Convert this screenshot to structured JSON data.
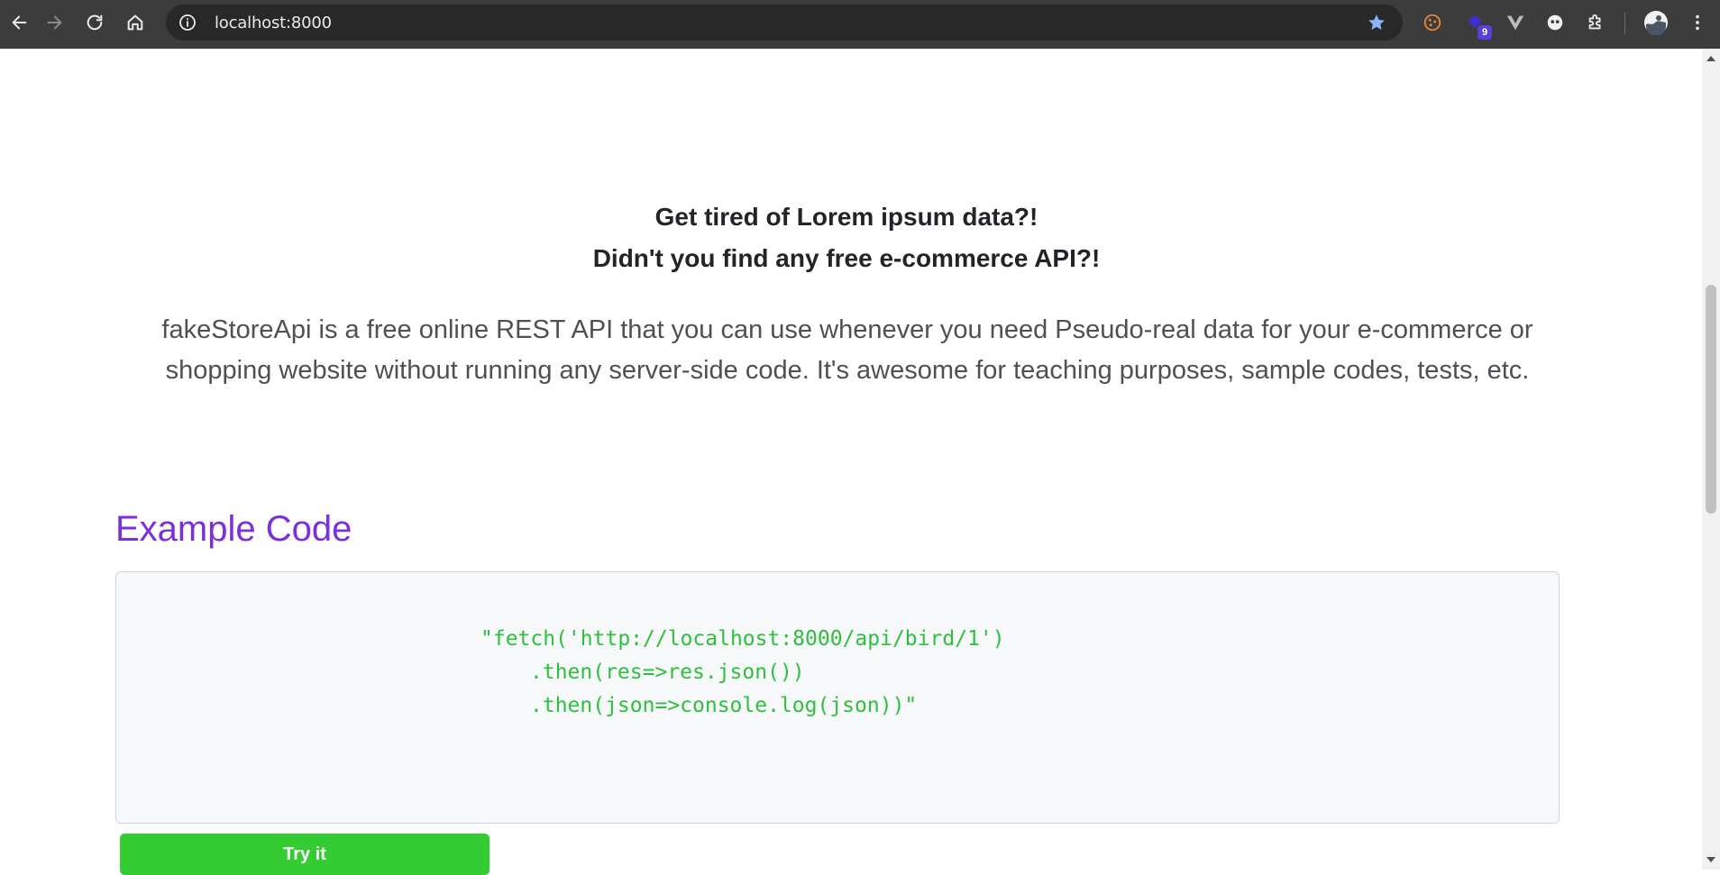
{
  "browser": {
    "url": "localhost:8000",
    "extension_badge_count": "9",
    "colors": {
      "chrome_bg": "#3c3c3c",
      "omnibox_bg": "#282828",
      "star": "#8ab4f8"
    },
    "icons": [
      "back-icon",
      "forward-icon",
      "reload-icon",
      "home-icon",
      "site-info-icon",
      "bookmark-star-icon",
      "cookie-extension-icon",
      "extension-icon",
      "vue-devtools-icon",
      "extension-icon",
      "extensions-puzzle-icon",
      "profile-avatar-icon",
      "menu-kebab-icon"
    ]
  },
  "hero": {
    "tagline_line1": "Get tired of Lorem ipsum data?!",
    "tagline_line2": "Didn't you find any free e-commerce API?!",
    "description": "fakeStoreApi is a free online REST API that you can use whenever you need Pseudo-real data for your e-commerce or shopping website without running any server-side code. It's awesome for teaching purposes, sample codes, tests, etc."
  },
  "example": {
    "title": "Example Code",
    "code_line1": "\"fetch('http://localhost:8000/api/bird/1')",
    "code_line2": ".then(res=>res.json())",
    "code_line3": ".then(json=>console.log(json))\"",
    "button_label": "Try it"
  },
  "colors": {
    "accent_purple": "#7b2fde",
    "code_green": "#2fbf3e",
    "button_green": "#33cc33",
    "code_bg": "#f6f8fa"
  }
}
